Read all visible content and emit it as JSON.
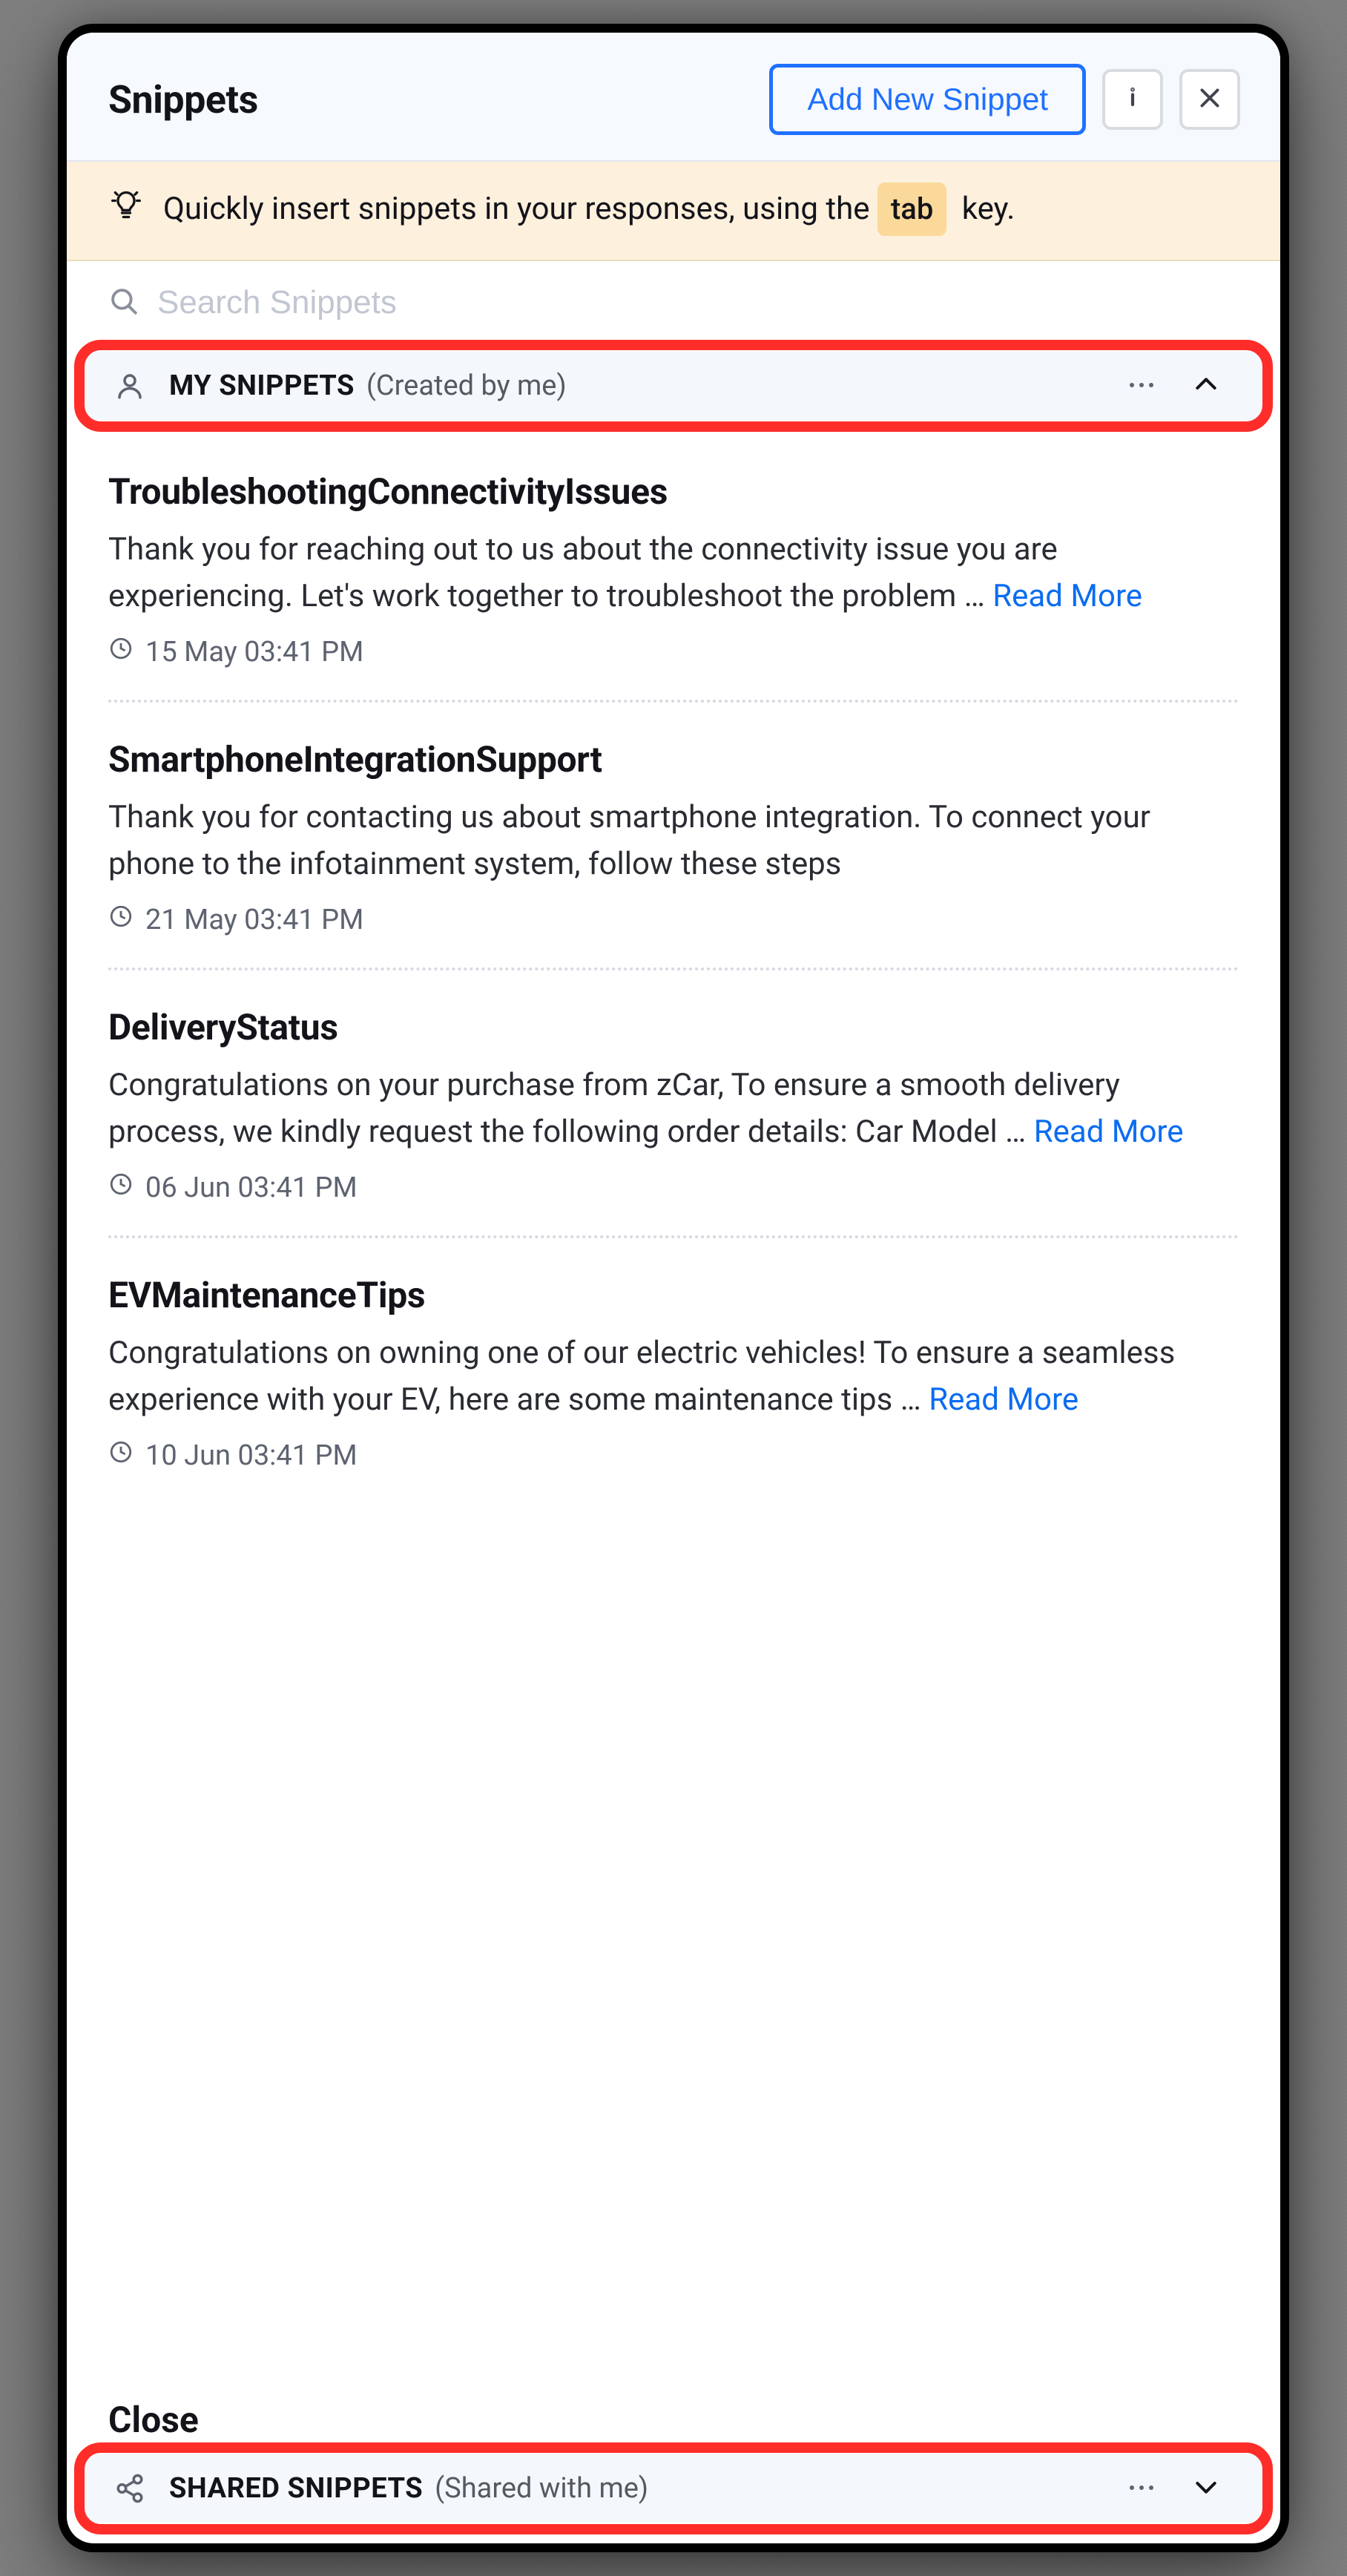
{
  "header": {
    "title": "Snippets",
    "add_label": "Add New Snippet"
  },
  "tip": {
    "text_pre": "Quickly insert snippets in your responses, using the",
    "chip": "tab",
    "text_post": "key."
  },
  "search": {
    "placeholder": "Search Snippets"
  },
  "sections": {
    "mine": {
      "title": "MY SNIPPETS",
      "subtitle": "(Created by me)",
      "expanded": true
    },
    "shared": {
      "title": "SHARED SNIPPETS",
      "subtitle": "(Shared with me)",
      "expanded": false
    }
  },
  "snippets": [
    {
      "title": "TroubleshootingConnectivityIssues",
      "body": "Thank you for reaching out to us about the connectivity issue you are experiencing. Let's work together to troubleshoot the problem …",
      "read_more": "Read More",
      "date": "15 May 03:41 PM"
    },
    {
      "title": "SmartphoneIntegrationSupport",
      "body": "Thank you for contacting us about smartphone integration. To connect your phone to the infotainment system, follow these steps",
      "read_more": "",
      "date": "21 May 03:41 PM"
    },
    {
      "title": "DeliveryStatus",
      "body": "Congratulations on your purchase from zCar, To ensure a smooth delivery process, we kindly request the following order details: Car Model …",
      "read_more": "Read More",
      "date": "06 Jun 03:41 PM"
    },
    {
      "title": "EVMaintenanceTips",
      "body": "Congratulations on owning one of our electric vehicles! To ensure a seamless experience with your EV, here are some maintenance tips …",
      "read_more": "Read More",
      "date": "10 Jun 03:41 PM"
    }
  ],
  "extra_item_title": "Close"
}
